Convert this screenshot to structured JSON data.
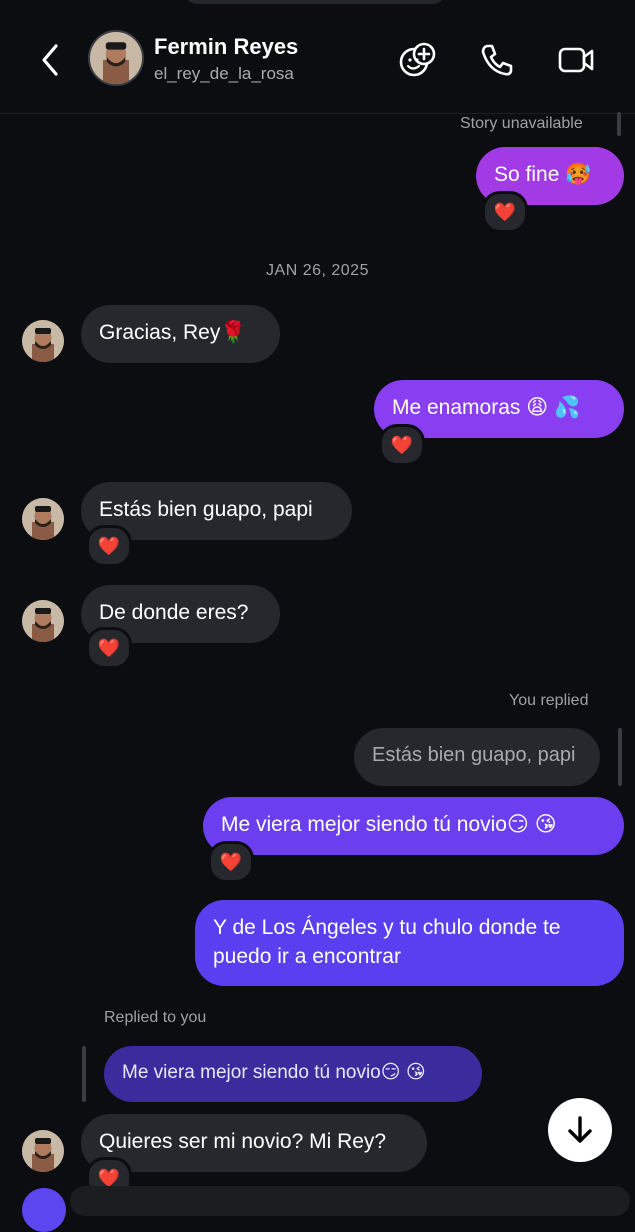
{
  "header": {
    "name": "Fermin Reyes",
    "handle": "el_rey_de_la_rosa"
  },
  "story_unavailable": "Story unavailable",
  "date_separator": "JAN 26, 2025",
  "you_replied": "You replied",
  "replied_to_you": "Replied to you",
  "reaction_emoji": "❤️",
  "messages": [
    {
      "from": "me",
      "text": "So fine 🥵",
      "reaction": "❤️"
    },
    {
      "from": "them",
      "text": "Gracias, Rey🌹"
    },
    {
      "from": "me",
      "text": "Me enamoras 😩 💦",
      "reaction": "❤️"
    },
    {
      "from": "them",
      "text": "Estás bien guapo, papi",
      "reaction": "❤️"
    },
    {
      "from": "them",
      "text": "De donde eres?",
      "reaction": "❤️"
    },
    {
      "from": "me_reply_preview",
      "text": "Estás bien guapo, papi"
    },
    {
      "from": "me",
      "text": "Me viera mejor siendo tú novio😏 😘",
      "reaction": "❤️"
    },
    {
      "from": "me",
      "text_line1": "Y de Los Ángeles y tu chulo donde te",
      "text_line2": "puedo ir a encontrar"
    },
    {
      "from": "them_reply_preview",
      "text": "Me viera mejor siendo tú novio😏 😘"
    },
    {
      "from": "them",
      "text": "Quieres ser mi novio? Mi Rey?",
      "reaction": "❤️"
    }
  ],
  "icons": [
    "chevron-left-icon",
    "sticker-add-icon",
    "phone-icon",
    "video-camera-icon",
    "arrow-down-icon"
  ]
}
